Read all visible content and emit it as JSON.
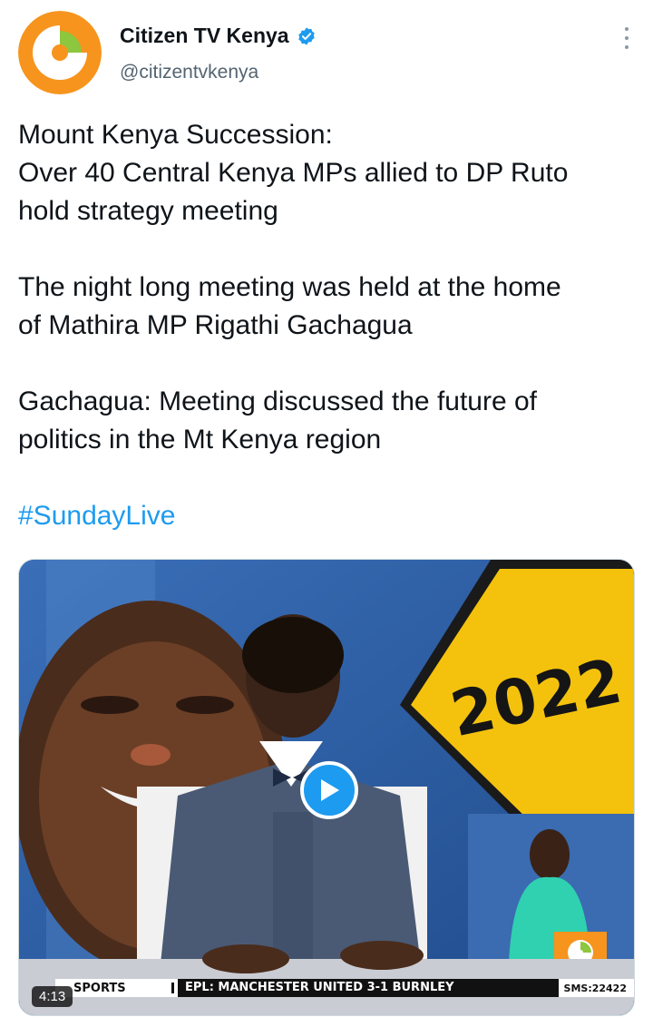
{
  "account": {
    "display_name": "Citizen TV Kenya",
    "handle": "@citizentvkenya",
    "verified": true,
    "avatar_colors": {
      "orange": "#f7941d",
      "green": "#8dc63f",
      "white": "#ffffff"
    }
  },
  "tweet": {
    "paragraphs": [
      [
        "Mount Kenya Succession:",
        "Over 40 Central Kenya MPs allied to DP Ruto",
        "hold strategy meeting"
      ],
      [
        "The night long meeting was held at the home",
        "of Mathira MP Rigathi Gachagua"
      ],
      [
        "Gachagua: Meeting discussed the future of",
        "politics in the Mt Kenya region"
      ]
    ],
    "hashtag": "#SundayLive"
  },
  "video": {
    "duration": "4:13",
    "sign_text": "2022",
    "ticker": {
      "section": "SPORTS",
      "headline": "EPL: MANCHESTER UNITED 3-1 BURNLEY",
      "sms": "SMS:22422"
    }
  },
  "icons": {
    "more": "more-vertical-icon",
    "verified": "verified-badge-icon",
    "play": "play-icon"
  },
  "colors": {
    "link": "#1d9bf0",
    "text": "#0f1419",
    "secondary": "#536471"
  }
}
